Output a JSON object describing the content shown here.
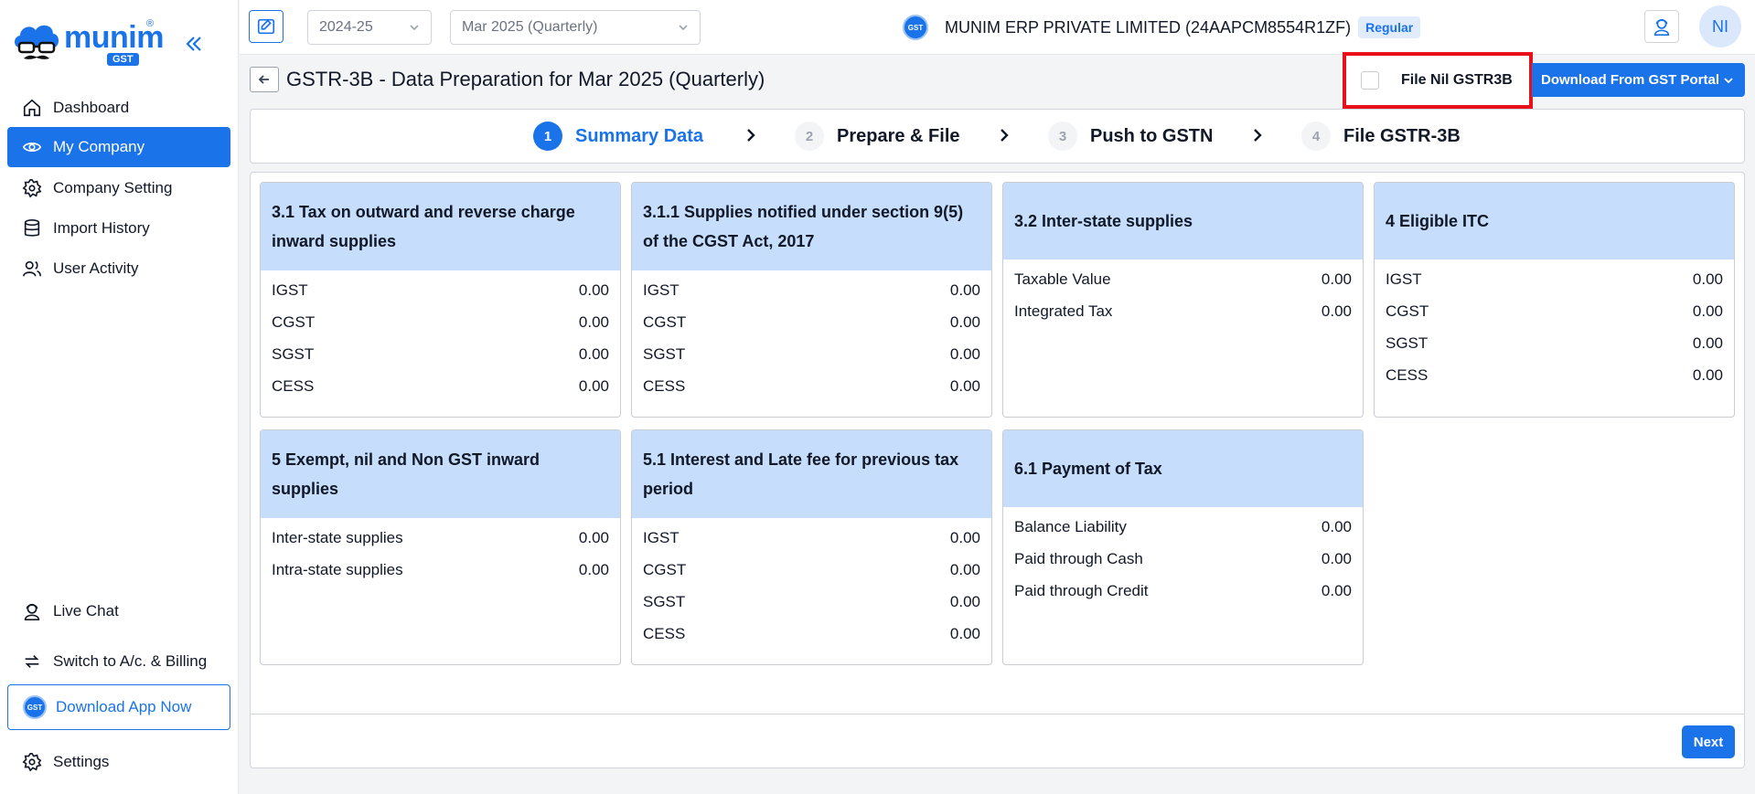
{
  "brand": {
    "name": "munim",
    "reg": "®",
    "badge": "GST"
  },
  "sidebar": {
    "items": [
      {
        "label": "Dashboard",
        "icon": "home-icon"
      },
      {
        "label": "My Company",
        "icon": "eye-icon"
      },
      {
        "label": "Company Setting",
        "icon": "gear-icon"
      },
      {
        "label": "Import History",
        "icon": "database-icon"
      },
      {
        "label": "User Activity",
        "icon": "users-icon"
      }
    ],
    "bottom": {
      "live_chat": "Live Chat",
      "switch": "Switch to A/c. & Billing",
      "download_app": "Download App Now",
      "settings": "Settings"
    }
  },
  "topbar": {
    "year": "2024-25",
    "period": "Mar 2025 (Quarterly)",
    "coin_text": "GST",
    "company": "MUNIM ERP PRIVATE LIMITED (24AAPCM8554R1ZF)",
    "badge": "Regular",
    "avatar": "NI"
  },
  "page": {
    "title": "GSTR-3B - Data Preparation for Mar 2025 (Quarterly)",
    "nil_label": "File Nil GSTR3B",
    "download_label": "Download From GST Portal"
  },
  "steps": [
    {
      "num": "1",
      "label": "Summary Data"
    },
    {
      "num": "2",
      "label": "Prepare & File"
    },
    {
      "num": "3",
      "label": "Push to GSTN"
    },
    {
      "num": "4",
      "label": "File GSTR-3B"
    }
  ],
  "cards": [
    {
      "title": "3.1 Tax on outward and reverse charge inward supplies",
      "rows": [
        [
          "IGST",
          "0.00"
        ],
        [
          "CGST",
          "0.00"
        ],
        [
          "SGST",
          "0.00"
        ],
        [
          "CESS",
          "0.00"
        ]
      ]
    },
    {
      "title": "3.1.1 Supplies notified under section 9(5) of the CGST Act, 2017",
      "rows": [
        [
          "IGST",
          "0.00"
        ],
        [
          "CGST",
          "0.00"
        ],
        [
          "SGST",
          "0.00"
        ],
        [
          "CESS",
          "0.00"
        ]
      ]
    },
    {
      "title": "3.2 Inter-state supplies",
      "rows": [
        [
          "Taxable Value",
          "0.00"
        ],
        [
          "Integrated Tax",
          "0.00"
        ]
      ]
    },
    {
      "title": "4 Eligible ITC",
      "rows": [
        [
          "IGST",
          "0.00"
        ],
        [
          "CGST",
          "0.00"
        ],
        [
          "SGST",
          "0.00"
        ],
        [
          "CESS",
          "0.00"
        ]
      ]
    },
    {
      "title": "5 Exempt, nil and Non GST inward supplies",
      "rows": [
        [
          "Inter-state supplies",
          "0.00"
        ],
        [
          "Intra-state supplies",
          "0.00"
        ]
      ]
    },
    {
      "title": "5.1 Interest and Late fee for previous tax period",
      "rows": [
        [
          "IGST",
          "0.00"
        ],
        [
          "CGST",
          "0.00"
        ],
        [
          "SGST",
          "0.00"
        ],
        [
          "CESS",
          "0.00"
        ]
      ]
    },
    {
      "title": "6.1 Payment of Tax",
      "rows": [
        [
          "Balance Liability",
          "0.00"
        ],
        [
          "Paid through Cash",
          "0.00"
        ],
        [
          "Paid through Credit",
          "0.00"
        ]
      ]
    }
  ],
  "footer": {
    "next": "Next"
  }
}
